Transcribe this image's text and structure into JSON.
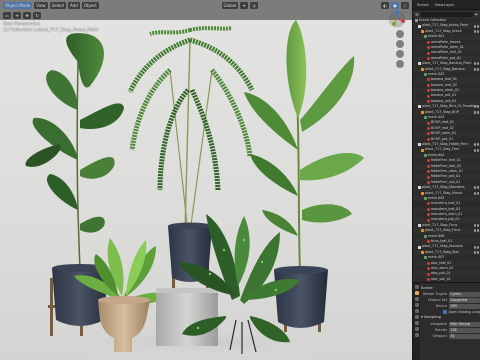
{
  "viewport": {
    "mode": "Object Mode",
    "menus": [
      "View",
      "Select",
      "Add",
      "Object"
    ],
    "transform": "Global",
    "overlay_lines": [
      "User Perspective",
      "(1) Collection | plant_717_Stag_Areca_Palm"
    ],
    "axes": [
      "X",
      "Y",
      "Z"
    ]
  },
  "header": {
    "scene": "Scene",
    "view_layer": "ViewLayer"
  },
  "outliner": {
    "title": "Scene Collection",
    "rows": [
      {
        "kind": "scn",
        "indent": 0,
        "label": "Scene Collection"
      },
      {
        "kind": "coll",
        "indent": 1,
        "label": "plant_717_Stag_Areca_Palm"
      },
      {
        "kind": "mesh",
        "indent": 2,
        "label": "plant_717_Stag_Areca"
      },
      {
        "kind": "data",
        "indent": 3,
        "label": "mesh.001"
      },
      {
        "kind": "mat",
        "indent": 4,
        "label": "arecaPalm_leaves"
      },
      {
        "kind": "mat",
        "indent": 4,
        "label": "arecaPalm_stem_01"
      },
      {
        "kind": "mat",
        "indent": 4,
        "label": "arecaPalm_leaf_02"
      },
      {
        "kind": "mat",
        "indent": 4,
        "label": "arecaPalm_pot_01"
      },
      {
        "kind": "coll",
        "indent": 1,
        "label": "plant_717_Stag_Banana_Plant"
      },
      {
        "kind": "mesh",
        "indent": 2,
        "label": "plant_717_Stag_Banana"
      },
      {
        "kind": "data",
        "indent": 3,
        "label": "mesh.002"
      },
      {
        "kind": "mat",
        "indent": 4,
        "label": "banana_leaf_01"
      },
      {
        "kind": "mat",
        "indent": 4,
        "label": "banana_leaf_02"
      },
      {
        "kind": "mat",
        "indent": 4,
        "label": "banana_stem_01"
      },
      {
        "kind": "mat",
        "indent": 4,
        "label": "banana_pot_01"
      },
      {
        "kind": "mat",
        "indent": 4,
        "label": "banana_soil_01"
      },
      {
        "kind": "coll",
        "indent": 1,
        "label": "plant_717_Stag_Bird_Of_Paradise"
      },
      {
        "kind": "mesh",
        "indent": 2,
        "label": "plant_717_Stag_BOP"
      },
      {
        "kind": "data",
        "indent": 3,
        "label": "mesh.003"
      },
      {
        "kind": "mat",
        "indent": 4,
        "label": "BOOP_leaf_01"
      },
      {
        "kind": "mat",
        "indent": 4,
        "label": "BOOP_leaf_02"
      },
      {
        "kind": "mat",
        "indent": 4,
        "label": "BOOP_stem_01"
      },
      {
        "kind": "mat",
        "indent": 4,
        "label": "BOOP_pot_01"
      },
      {
        "kind": "coll",
        "indent": 1,
        "label": "plant_717_Stag_Fiddle_Fern"
      },
      {
        "kind": "mesh",
        "indent": 2,
        "label": "plant_717_Stag_Fern"
      },
      {
        "kind": "data",
        "indent": 3,
        "label": "mesh.004"
      },
      {
        "kind": "mat",
        "indent": 4,
        "label": "fiddleFern_leaf_01"
      },
      {
        "kind": "mat",
        "indent": 4,
        "label": "fiddleFern_leaf_02"
      },
      {
        "kind": "mat",
        "indent": 4,
        "label": "fiddleFern_stem_01"
      },
      {
        "kind": "mat",
        "indent": 4,
        "label": "fiddleFern_pot_01"
      },
      {
        "kind": "mat",
        "indent": 4,
        "label": "fiddleFern_soil_01"
      },
      {
        "kind": "coll",
        "indent": 1,
        "label": "plant_717_Stag_Monstera"
      },
      {
        "kind": "mesh",
        "indent": 2,
        "label": "plant_717_Stag_Monst"
      },
      {
        "kind": "data",
        "indent": 3,
        "label": "mesh.005"
      },
      {
        "kind": "mat",
        "indent": 4,
        "label": "monstera_leaf_01"
      },
      {
        "kind": "mat",
        "indent": 4,
        "label": "monstera_leaf_02"
      },
      {
        "kind": "mat",
        "indent": 4,
        "label": "monstera_stem_01"
      },
      {
        "kind": "mat",
        "indent": 4,
        "label": "monstera_pot_01"
      },
      {
        "kind": "coll",
        "indent": 1,
        "label": "plant_717_Stag_Ficus"
      },
      {
        "kind": "mesh",
        "indent": 2,
        "label": "plant_717_Stag_Ficus"
      },
      {
        "kind": "data",
        "indent": 3,
        "label": "mesh.006"
      },
      {
        "kind": "mat",
        "indent": 4,
        "label": "ficus_leaf_01"
      },
      {
        "kind": "coll",
        "indent": 1,
        "label": "plant_717_Stag_Alocasia"
      },
      {
        "kind": "mesh",
        "indent": 2,
        "label": "plant_717_Stag_Aloc"
      },
      {
        "kind": "data",
        "indent": 3,
        "label": "mesh.007"
      },
      {
        "kind": "mat",
        "indent": 4,
        "label": "aloc_leaf_01"
      },
      {
        "kind": "mat",
        "indent": 4,
        "label": "aloc_stem_01"
      },
      {
        "kind": "mat",
        "indent": 4,
        "label": "aloc_pot_01"
      },
      {
        "kind": "mat",
        "indent": 4,
        "label": "aloc_soil_01"
      },
      {
        "kind": "mat",
        "indent": 4,
        "label": "aloc_pebbles"
      },
      {
        "kind": "mat",
        "indent": 4,
        "label": "aloc_ground"
      }
    ]
  },
  "properties": {
    "title": "Scene",
    "rows": [
      {
        "label": "Render Engine",
        "value": "Cycles"
      },
      {
        "label": "Feature Set",
        "value": "Supported"
      },
      {
        "label": "Device",
        "value": "GPU"
      }
    ],
    "checkbox_label": "Open Shading Language",
    "section": "Sampling",
    "section_rows": [
      {
        "label": "Integrator",
        "value": "Path Tracing"
      },
      {
        "label": "Render",
        "value": "128"
      },
      {
        "label": "Viewport",
        "value": "32"
      }
    ]
  }
}
